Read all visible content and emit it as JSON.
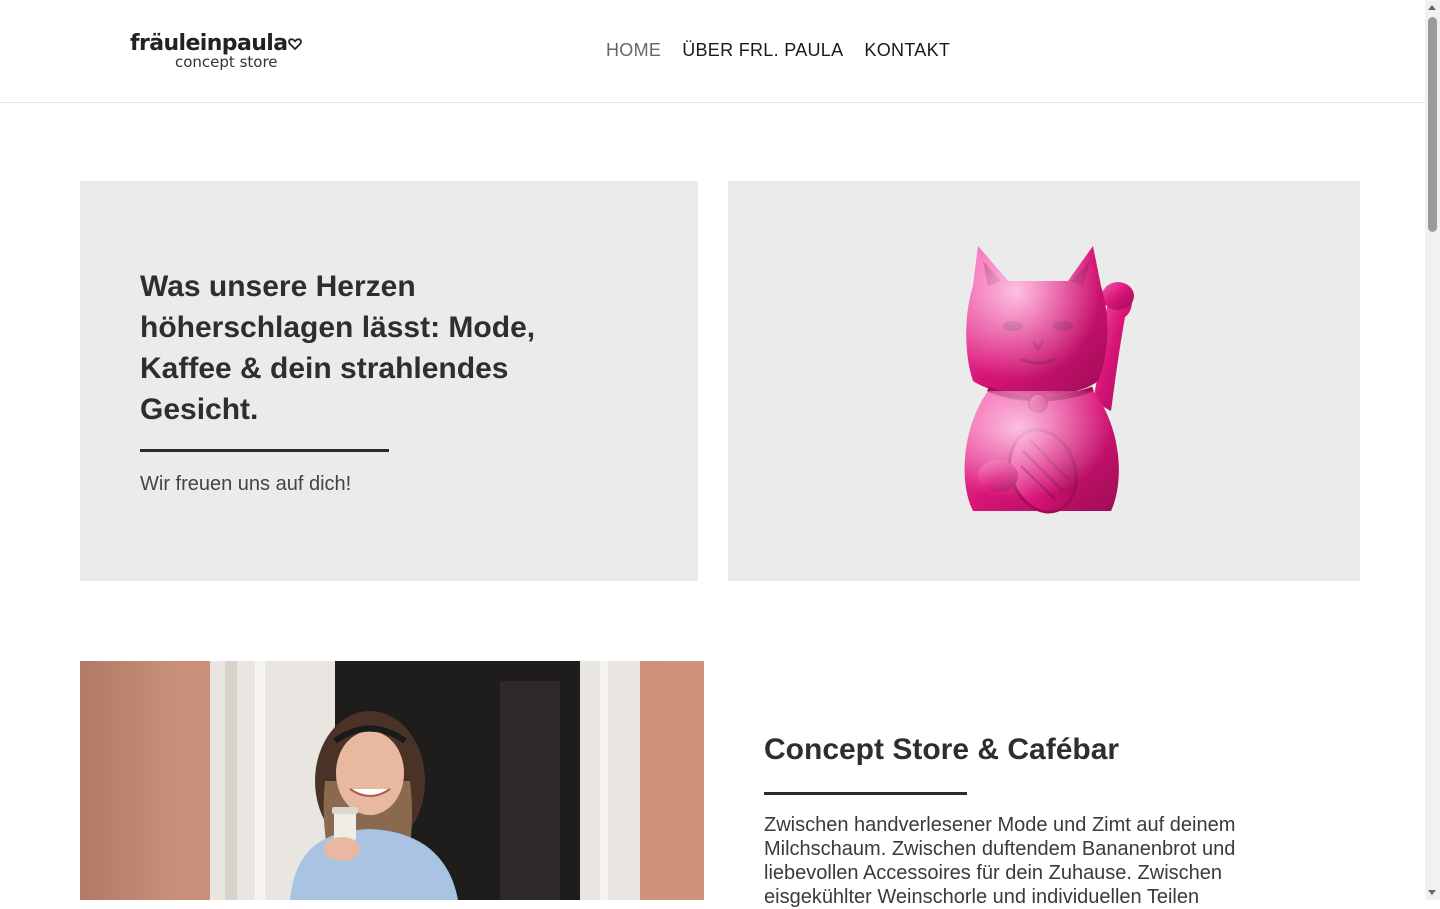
{
  "header": {
    "logo_main": "fräuleinpaula",
    "logo_sub": "concept store",
    "nav": [
      {
        "label": "HOME",
        "active": true
      },
      {
        "label": "ÜBER FRL. PAULA",
        "active": false
      },
      {
        "label": "KONTAKT",
        "active": false
      }
    ]
  },
  "hero": {
    "title": "Was unsere Herzen höherschlagen lässt: Mode, Kaffee & dein strahlendes Gesicht.",
    "subtitle": "Wir freuen uns auf dich!",
    "image_icon": "pink-lucky-cat-figurine",
    "image_color": "#e0207f"
  },
  "section": {
    "title": "Concept Store & Cafébar",
    "body": "Zwischen handverlesener Mode und Zimt auf deinem Milchschaum. Zwischen duftendem Bananenbrot und liebevollen Accessoires für dein Zuhause. Zwischen eisgekühlter Weinschorle und individuellen Teilen",
    "photo_icon": "woman-with-coffee-cup-photo"
  },
  "colors": {
    "panel_bg": "#ebebeb",
    "text_dark": "#2e2e2e",
    "accent_pink": "#e0207f"
  }
}
